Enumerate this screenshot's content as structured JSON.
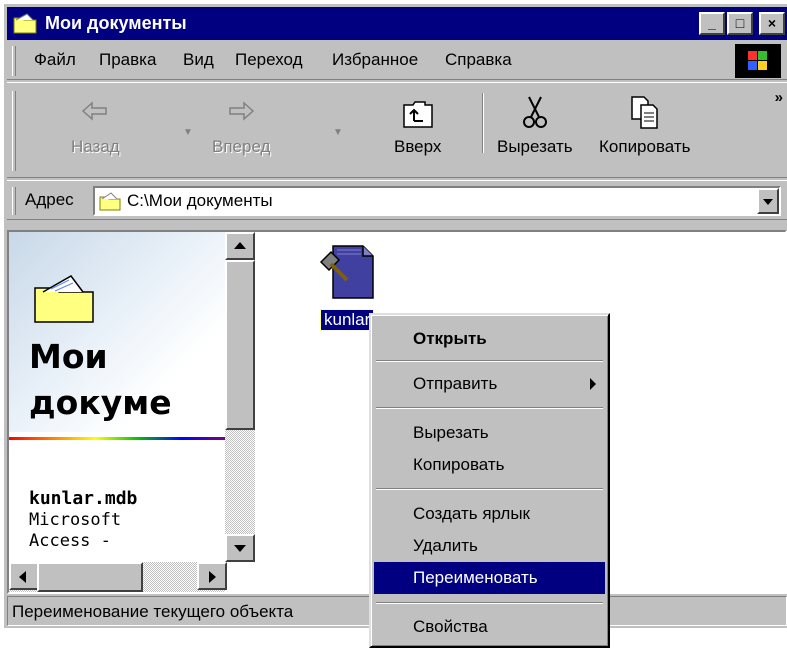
{
  "window": {
    "title": "Мои документы",
    "title_icon": "folder-icon",
    "controls": [
      "minimize-icon",
      "maximize-icon",
      "close-icon"
    ],
    "minimize_glyph": "_",
    "maximize_glyph": "□",
    "close_glyph": "×"
  },
  "menubar": {
    "items": [
      "Файл",
      "Правка",
      "Вид",
      "Переход",
      "Избранное",
      "Справка"
    ]
  },
  "toolbar": {
    "back_label": "Назад",
    "forward_label": "Вперед",
    "up_label": "Вверх",
    "cut_label": "Вырезать",
    "copy_label": "Копировать",
    "more_glyph": "»"
  },
  "addressbar": {
    "label": "Адрес",
    "value": "C:\\Мои документы"
  },
  "webview": {
    "title_line1": "Мои",
    "title_line2": "докуме",
    "file_name": "kunlar.mdb",
    "file_desc_line1": "Microsoft",
    "file_desc_line2": "Access -"
  },
  "files": [
    {
      "label": "kunlar",
      "icon": "access-database-icon",
      "selected": true
    }
  ],
  "context_menu": {
    "items": [
      {
        "label": "Открыть",
        "bold": true
      },
      {
        "label": "Отправить",
        "submenu": true
      },
      {
        "label": "Вырезать"
      },
      {
        "label": "Копировать"
      },
      {
        "label": "Создать ярлык"
      },
      {
        "label": "Удалить"
      },
      {
        "label": "Переименовать",
        "highlighted": true
      },
      {
        "label": "Свойства"
      }
    ]
  },
  "statusbar": {
    "text": "Переименование текущего объекта"
  },
  "colors": {
    "titlebar": "#000080",
    "face": "#c0c0c0",
    "highlight": "#000080"
  }
}
